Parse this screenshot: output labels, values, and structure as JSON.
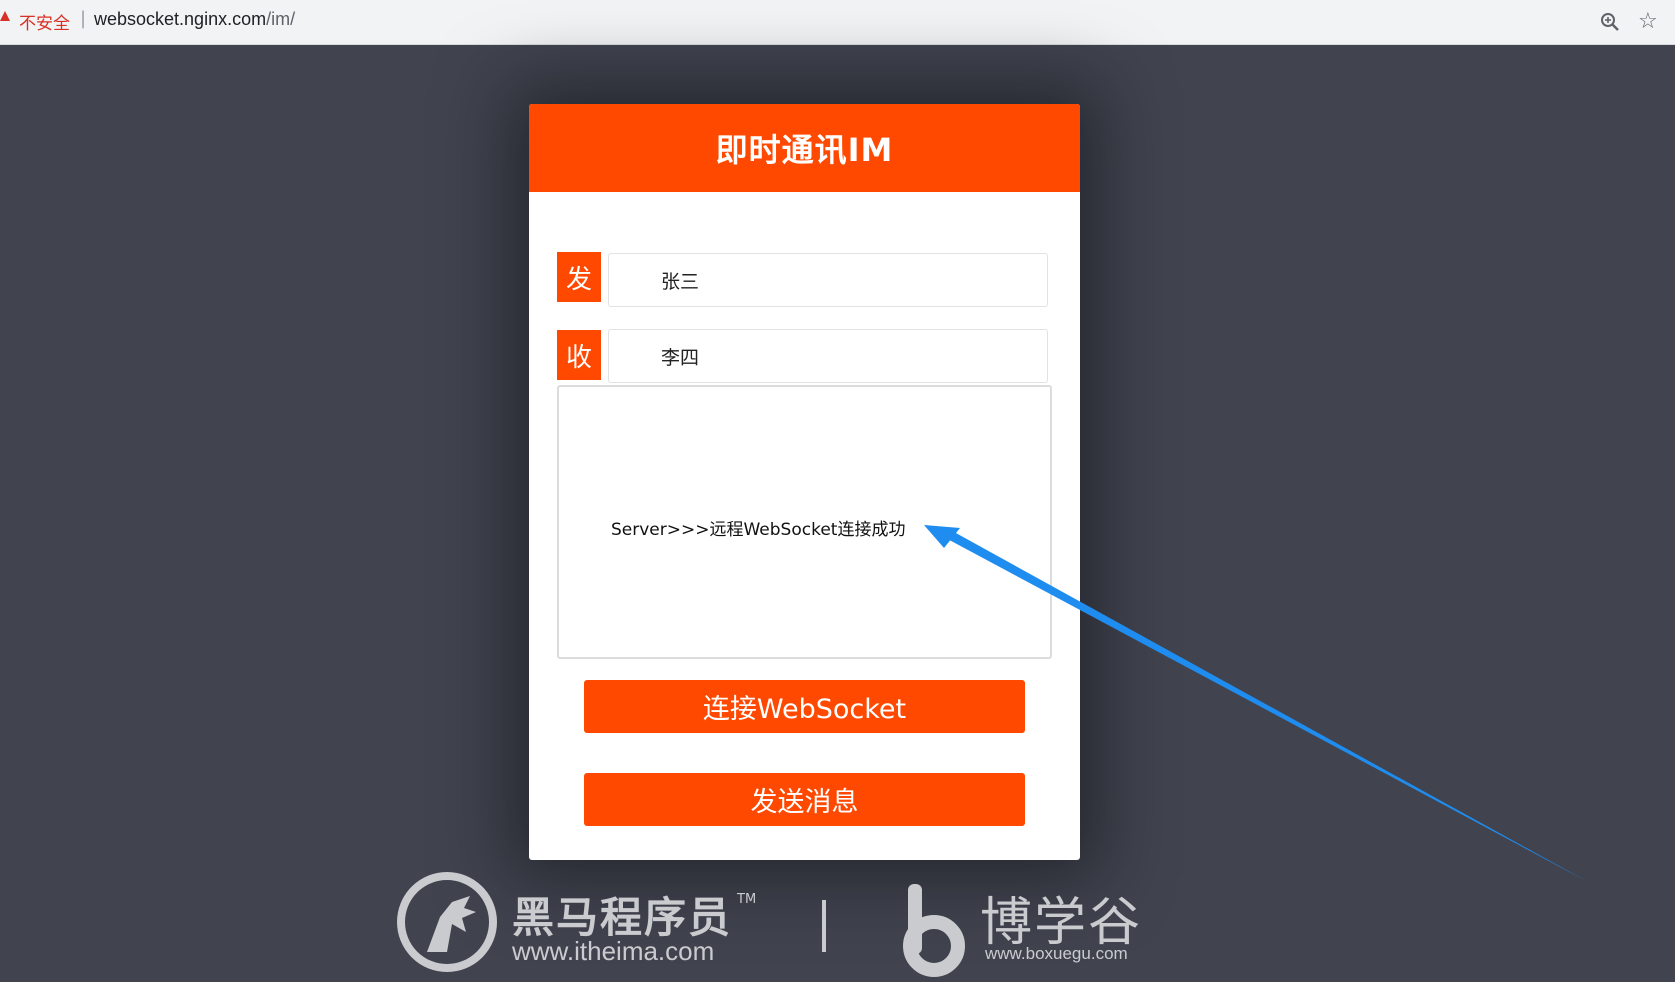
{
  "browser": {
    "security_label": "不安全",
    "separator": "|",
    "url_host": "websocket.nginx.com",
    "url_path": "/im/",
    "icons": [
      "warning-icon",
      "zoom-icon",
      "bookmark-star-icon"
    ]
  },
  "app": {
    "title": "即时通讯IM",
    "sender_label": "发",
    "sender_value": "张三",
    "receiver_label": "收",
    "receiver_value": "李四",
    "messages": [
      "Server>>>远程WebSocket连接成功"
    ],
    "connect_button": "连接WebSocket",
    "send_button": "发送消息"
  },
  "colors": {
    "accent": "#ff4800",
    "background": "#41444f",
    "annotation_arrow": "#1f8df0",
    "security_warning": "#d93025"
  },
  "watermark": {
    "brand_left": "黑马程序员",
    "trademark": "TM",
    "url_left": "www.itheima.com",
    "divider": "|",
    "brand_right": "博学谷",
    "url_right": "www.boxuegu.com"
  }
}
